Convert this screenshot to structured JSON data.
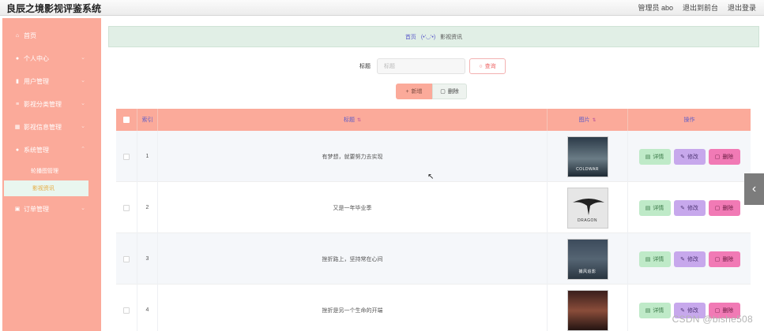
{
  "app": {
    "title": "良辰之境影视评鉴系统"
  },
  "topbar": {
    "admin": "管理员 abo",
    "front": "退出到前台",
    "logout": "退出登录"
  },
  "sidebar": {
    "items": [
      {
        "label": "首页",
        "icon": "home-icon"
      },
      {
        "label": "个人中心",
        "icon": "user-icon"
      },
      {
        "label": "用户管理",
        "icon": "bar-chart-icon"
      },
      {
        "label": "影视分类管理",
        "icon": "list-icon"
      },
      {
        "label": "影视信息管理",
        "icon": "grid-icon"
      },
      {
        "label": "系统管理",
        "icon": "dot-icon"
      }
    ],
    "submenu": [
      {
        "label": "轮播图管理"
      },
      {
        "label": "影视资讯"
      }
    ],
    "order": {
      "label": "订单管理",
      "icon": "card-icon"
    }
  },
  "breadcrumb": {
    "home": "首页",
    "face": "(•'◡'•)",
    "current": "影视资讯"
  },
  "search": {
    "label": "标题",
    "placeholder": "标题",
    "button": "查询"
  },
  "actions": {
    "add": "新增",
    "delete": "删除"
  },
  "table": {
    "headers": {
      "index": "索引",
      "title": "标题",
      "image": "图片",
      "ops": "操作"
    },
    "op_labels": {
      "detail": "详情",
      "edit": "修改",
      "remove": "删除"
    },
    "rows": [
      {
        "index": "1",
        "title": "有梦想，就要努力去实现",
        "poster_text": "COLDWAR"
      },
      {
        "index": "2",
        "title": "又是一年毕业季",
        "poster_text": "DRAGON"
      },
      {
        "index": "3",
        "title": "挫折路上，坚持常在心间",
        "poster_text": "捕风追影"
      },
      {
        "index": "4",
        "title": "挫折是另一个生命的开端",
        "poster_text": ""
      }
    ]
  },
  "watermark": "CSDN @bishe508",
  "colors": {
    "accent": "#fbaa9a",
    "link": "#5b5bc9",
    "detail": "#bfeac8",
    "edit": "#c7a8ec",
    "remove": "#f17ab5"
  }
}
